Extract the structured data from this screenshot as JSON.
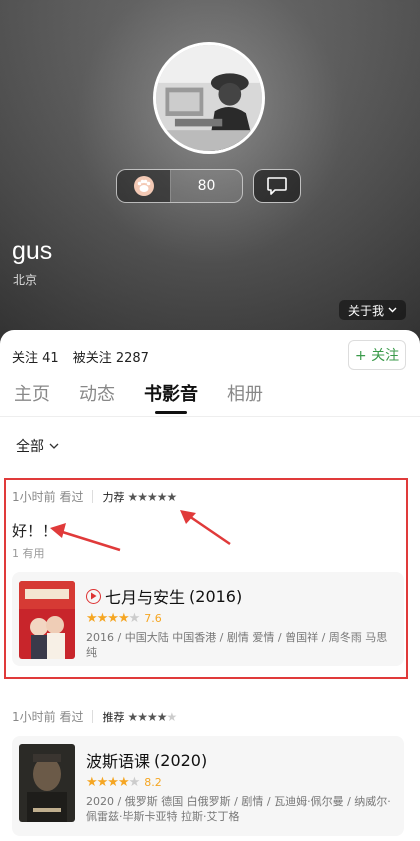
{
  "profile": {
    "like_count": "80",
    "username": "gus",
    "location": "北京",
    "about_label": "关于我"
  },
  "stats": {
    "following": "关注 41",
    "followers": "被关注 2287",
    "follow_button": "+ 关注"
  },
  "tabs": [
    {
      "label": "主页",
      "active": false
    },
    {
      "label": "动态",
      "active": false
    },
    {
      "label": "书影音",
      "active": true
    },
    {
      "label": "相册",
      "active": false
    }
  ],
  "filter": {
    "label": "全部"
  },
  "feed": [
    {
      "time": "1小时前 看过",
      "rec_label": "力荐",
      "stars": 5,
      "comment": "好！！",
      "useful": "1 有用",
      "movie": {
        "title": "七月与安生",
        "year": "(2016)",
        "rating": "7.6",
        "rating_stars": 4,
        "info": "2016 / 中国大陆 中国香港 / 剧情 爱情 / 曾国祥 / 周冬雨 马思纯",
        "has_play": true
      }
    },
    {
      "time": "1小时前 看过",
      "rec_label": "推荐",
      "stars": 4,
      "movie": {
        "title": "波斯语课",
        "year": "(2020)",
        "rating": "8.2",
        "rating_stars": 4,
        "info": "2020 / 俄罗斯 德国 白俄罗斯 / 剧情 / 瓦迪姆·佩尔曼 / 纳威尔·佩雷兹·毕斯卡亚特 拉斯·艾丁格",
        "has_play": false
      }
    }
  ],
  "colors": {
    "accent_green": "#3a9a4a",
    "star_yellow": "#f5a623",
    "annotation_red": "#e03a3a"
  }
}
